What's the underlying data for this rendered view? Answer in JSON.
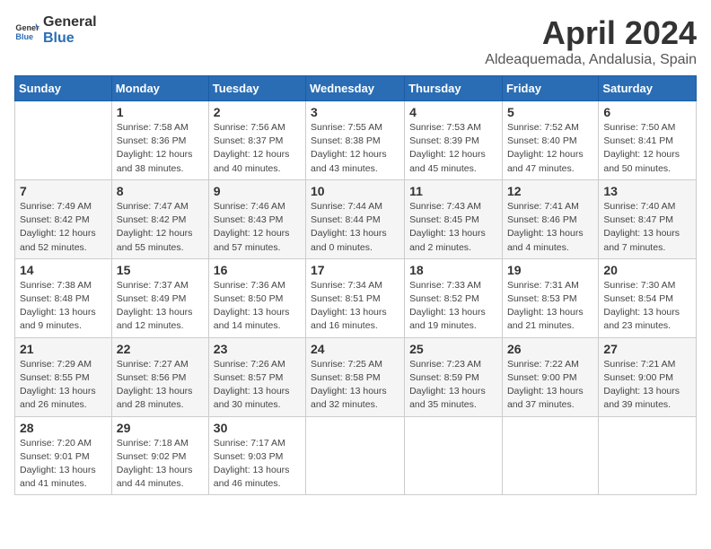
{
  "header": {
    "logo": {
      "general": "General",
      "blue": "Blue"
    },
    "month_title": "April 2024",
    "location": "Aldeaquemada, Andalusia, Spain"
  },
  "weekdays": [
    "Sunday",
    "Monday",
    "Tuesday",
    "Wednesday",
    "Thursday",
    "Friday",
    "Saturday"
  ],
  "weeks": [
    [
      {
        "day": "",
        "info": ""
      },
      {
        "day": "1",
        "info": "Sunrise: 7:58 AM\nSunset: 8:36 PM\nDaylight: 12 hours\nand 38 minutes."
      },
      {
        "day": "2",
        "info": "Sunrise: 7:56 AM\nSunset: 8:37 PM\nDaylight: 12 hours\nand 40 minutes."
      },
      {
        "day": "3",
        "info": "Sunrise: 7:55 AM\nSunset: 8:38 PM\nDaylight: 12 hours\nand 43 minutes."
      },
      {
        "day": "4",
        "info": "Sunrise: 7:53 AM\nSunset: 8:39 PM\nDaylight: 12 hours\nand 45 minutes."
      },
      {
        "day": "5",
        "info": "Sunrise: 7:52 AM\nSunset: 8:40 PM\nDaylight: 12 hours\nand 47 minutes."
      },
      {
        "day": "6",
        "info": "Sunrise: 7:50 AM\nSunset: 8:41 PM\nDaylight: 12 hours\nand 50 minutes."
      }
    ],
    [
      {
        "day": "7",
        "info": "Sunrise: 7:49 AM\nSunset: 8:42 PM\nDaylight: 12 hours\nand 52 minutes."
      },
      {
        "day": "8",
        "info": "Sunrise: 7:47 AM\nSunset: 8:42 PM\nDaylight: 12 hours\nand 55 minutes."
      },
      {
        "day": "9",
        "info": "Sunrise: 7:46 AM\nSunset: 8:43 PM\nDaylight: 12 hours\nand 57 minutes."
      },
      {
        "day": "10",
        "info": "Sunrise: 7:44 AM\nSunset: 8:44 PM\nDaylight: 13 hours\nand 0 minutes."
      },
      {
        "day": "11",
        "info": "Sunrise: 7:43 AM\nSunset: 8:45 PM\nDaylight: 13 hours\nand 2 minutes."
      },
      {
        "day": "12",
        "info": "Sunrise: 7:41 AM\nSunset: 8:46 PM\nDaylight: 13 hours\nand 4 minutes."
      },
      {
        "day": "13",
        "info": "Sunrise: 7:40 AM\nSunset: 8:47 PM\nDaylight: 13 hours\nand 7 minutes."
      }
    ],
    [
      {
        "day": "14",
        "info": "Sunrise: 7:38 AM\nSunset: 8:48 PM\nDaylight: 13 hours\nand 9 minutes."
      },
      {
        "day": "15",
        "info": "Sunrise: 7:37 AM\nSunset: 8:49 PM\nDaylight: 13 hours\nand 12 minutes."
      },
      {
        "day": "16",
        "info": "Sunrise: 7:36 AM\nSunset: 8:50 PM\nDaylight: 13 hours\nand 14 minutes."
      },
      {
        "day": "17",
        "info": "Sunrise: 7:34 AM\nSunset: 8:51 PM\nDaylight: 13 hours\nand 16 minutes."
      },
      {
        "day": "18",
        "info": "Sunrise: 7:33 AM\nSunset: 8:52 PM\nDaylight: 13 hours\nand 19 minutes."
      },
      {
        "day": "19",
        "info": "Sunrise: 7:31 AM\nSunset: 8:53 PM\nDaylight: 13 hours\nand 21 minutes."
      },
      {
        "day": "20",
        "info": "Sunrise: 7:30 AM\nSunset: 8:54 PM\nDaylight: 13 hours\nand 23 minutes."
      }
    ],
    [
      {
        "day": "21",
        "info": "Sunrise: 7:29 AM\nSunset: 8:55 PM\nDaylight: 13 hours\nand 26 minutes."
      },
      {
        "day": "22",
        "info": "Sunrise: 7:27 AM\nSunset: 8:56 PM\nDaylight: 13 hours\nand 28 minutes."
      },
      {
        "day": "23",
        "info": "Sunrise: 7:26 AM\nSunset: 8:57 PM\nDaylight: 13 hours\nand 30 minutes."
      },
      {
        "day": "24",
        "info": "Sunrise: 7:25 AM\nSunset: 8:58 PM\nDaylight: 13 hours\nand 32 minutes."
      },
      {
        "day": "25",
        "info": "Sunrise: 7:23 AM\nSunset: 8:59 PM\nDaylight: 13 hours\nand 35 minutes."
      },
      {
        "day": "26",
        "info": "Sunrise: 7:22 AM\nSunset: 9:00 PM\nDaylight: 13 hours\nand 37 minutes."
      },
      {
        "day": "27",
        "info": "Sunrise: 7:21 AM\nSunset: 9:00 PM\nDaylight: 13 hours\nand 39 minutes."
      }
    ],
    [
      {
        "day": "28",
        "info": "Sunrise: 7:20 AM\nSunset: 9:01 PM\nDaylight: 13 hours\nand 41 minutes."
      },
      {
        "day": "29",
        "info": "Sunrise: 7:18 AM\nSunset: 9:02 PM\nDaylight: 13 hours\nand 44 minutes."
      },
      {
        "day": "30",
        "info": "Sunrise: 7:17 AM\nSunset: 9:03 PM\nDaylight: 13 hours\nand 46 minutes."
      },
      {
        "day": "",
        "info": ""
      },
      {
        "day": "",
        "info": ""
      },
      {
        "day": "",
        "info": ""
      },
      {
        "day": "",
        "info": ""
      }
    ]
  ]
}
